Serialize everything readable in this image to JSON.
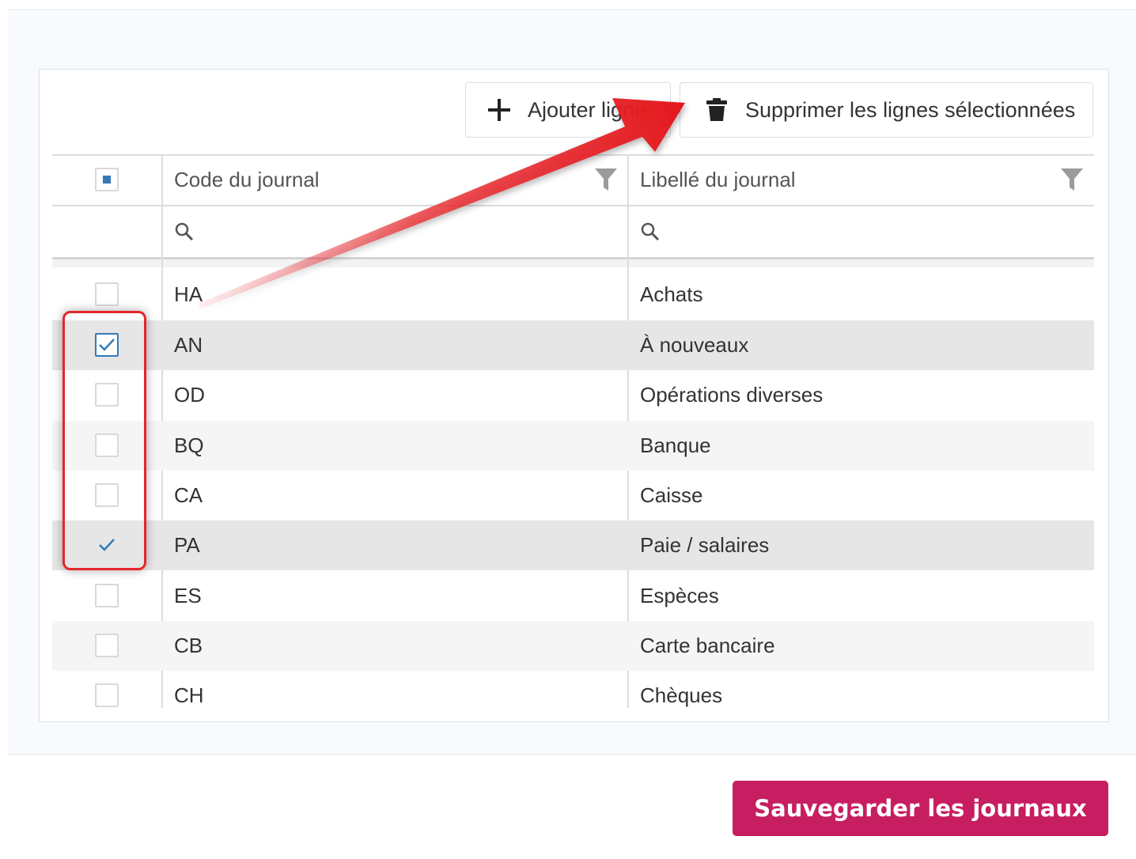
{
  "toolbar": {
    "add_label": "Ajouter ligne",
    "delete_label": "Supprimer les lignes sélectionnées"
  },
  "grid": {
    "columns": [
      {
        "key": "code",
        "header": "Code du journal"
      },
      {
        "key": "label",
        "header": "Libellé du journal"
      }
    ],
    "select_all_state": "indeterminate",
    "rows": [
      {
        "code": "HA",
        "label": "Achats",
        "checked": false
      },
      {
        "code": "AN",
        "label": "À nouveaux",
        "checked": true
      },
      {
        "code": "OD",
        "label": "Opérations diverses",
        "checked": false
      },
      {
        "code": "BQ",
        "label": "Banque",
        "checked": false
      },
      {
        "code": "CA",
        "label": "Caisse",
        "checked": false
      },
      {
        "code": "PA",
        "label": "Paie / salaires",
        "checked": true
      },
      {
        "code": "ES",
        "label": "Espèces",
        "checked": false
      },
      {
        "code": "CB",
        "label": "Carte bancaire",
        "checked": false
      },
      {
        "code": "CH",
        "label": "Chèques",
        "checked": false
      }
    ]
  },
  "footer": {
    "save_label": "Sauvegarder les journaux"
  },
  "colors": {
    "accent": "#c71e61",
    "checkbox": "#337ab7",
    "annotation": "#e5262b"
  },
  "icons": [
    "plus-icon",
    "trash-icon",
    "filter-icon",
    "search-icon",
    "check-icon"
  ]
}
